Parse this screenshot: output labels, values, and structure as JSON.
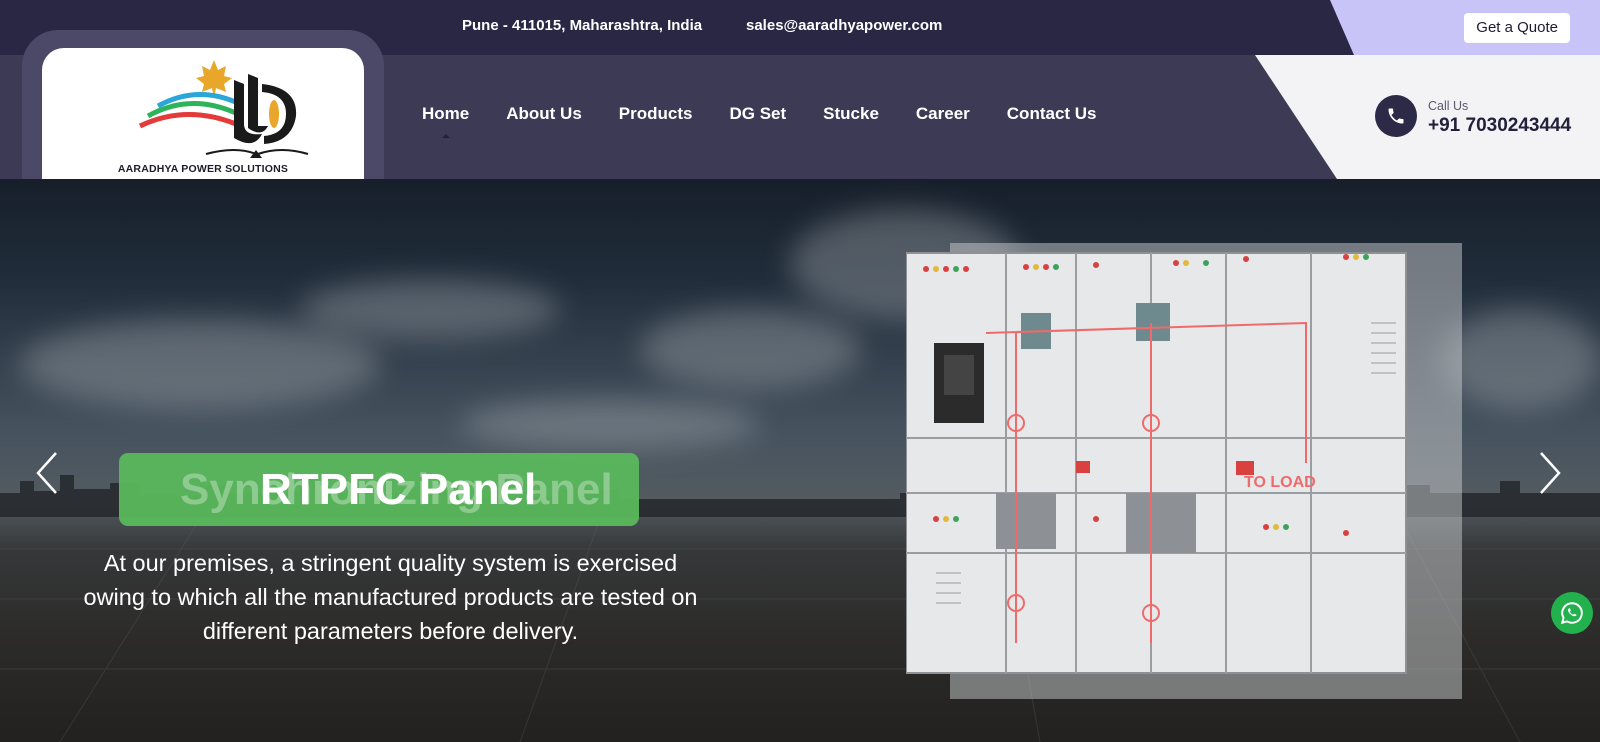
{
  "topbar": {
    "address": "Pune - 411015, Maharashtra, India",
    "email": "sales@aaradhyapower.com",
    "quote_label": "Get a Quote"
  },
  "brand": {
    "name": "AARADHYA POWER SOLUTIONS"
  },
  "nav": {
    "items": [
      {
        "label": "Home",
        "active": true
      },
      {
        "label": "About Us"
      },
      {
        "label": "Products"
      },
      {
        "label": "DG Set"
      },
      {
        "label": "Stucke"
      },
      {
        "label": "Career"
      },
      {
        "label": "Contact Us"
      }
    ]
  },
  "contact": {
    "call_label": "Call Us",
    "phone": "+91 7030243444",
    "icon": "phone-icon"
  },
  "hero": {
    "ghost_title": "Synchronizing Panel",
    "title": "RTPFC Panel",
    "description": "At our premises, a stringent quality system is exercised owing to which all the manufactured products are tested on different parameters before delivery.",
    "panel_label": "TO LOAD",
    "prev_icon": "chevron-left-icon",
    "next_icon": "chevron-right-icon"
  },
  "floating": {
    "whatsapp_icon": "whatsapp-icon"
  },
  "colors": {
    "topbar": "#2a2745",
    "navbar": "#3d3a56",
    "accent": "#c9c4f7",
    "title_green": "#5ab85c",
    "whatsapp": "#22b14c"
  }
}
